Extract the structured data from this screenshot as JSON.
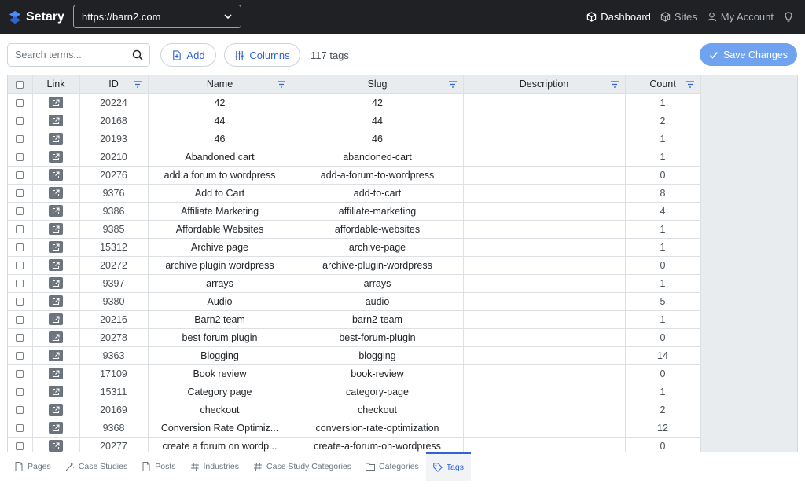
{
  "app": {
    "name": "Setary"
  },
  "site_select": {
    "value": "https://barn2.com"
  },
  "nav": [
    {
      "label": "Dashboard",
      "icon": "cube-icon",
      "active": true
    },
    {
      "label": "Sites",
      "icon": "cubes-icon",
      "active": false
    },
    {
      "label": "My Account",
      "icon": "user-icon",
      "active": false
    }
  ],
  "toolbar": {
    "search_placeholder": "Search terms...",
    "add_label": "Add",
    "columns_label": "Columns",
    "count_text": "117 tags",
    "save_label": "Save Changes"
  },
  "table": {
    "columns": [
      "Link",
      "ID",
      "Name",
      "Slug",
      "Description",
      "Count"
    ],
    "rows": [
      {
        "id": "20224",
        "name": "42",
        "slug": "42",
        "description": "",
        "count": "1"
      },
      {
        "id": "20168",
        "name": "44",
        "slug": "44",
        "description": "",
        "count": "2"
      },
      {
        "id": "20193",
        "name": "46",
        "slug": "46",
        "description": "",
        "count": "1"
      },
      {
        "id": "20210",
        "name": "Abandoned cart",
        "slug": "abandoned-cart",
        "description": "",
        "count": "1"
      },
      {
        "id": "20276",
        "name": "add a forum to wordpress",
        "slug": "add-a-forum-to-wordpress",
        "description": "",
        "count": "0"
      },
      {
        "id": "9376",
        "name": "Add to Cart",
        "slug": "add-to-cart",
        "description": "",
        "count": "8"
      },
      {
        "id": "9386",
        "name": "Affiliate Marketing",
        "slug": "affiliate-marketing",
        "description": "",
        "count": "4"
      },
      {
        "id": "9385",
        "name": "Affordable Websites",
        "slug": "affordable-websites",
        "description": "",
        "count": "1"
      },
      {
        "id": "15312",
        "name": "Archive page",
        "slug": "archive-page",
        "description": "",
        "count": "1"
      },
      {
        "id": "20272",
        "name": "archive plugin wordpress",
        "slug": "archive-plugin-wordpress",
        "description": "",
        "count": "0"
      },
      {
        "id": "9397",
        "name": "arrays",
        "slug": "arrays",
        "description": "",
        "count": "1"
      },
      {
        "id": "9380",
        "name": "Audio",
        "slug": "audio",
        "description": "",
        "count": "5"
      },
      {
        "id": "20216",
        "name": "Barn2 team",
        "slug": "barn2-team",
        "description": "",
        "count": "1"
      },
      {
        "id": "20278",
        "name": "best forum plugin",
        "slug": "best-forum-plugin",
        "description": "",
        "count": "0"
      },
      {
        "id": "9363",
        "name": "Blogging",
        "slug": "blogging",
        "description": "",
        "count": "14"
      },
      {
        "id": "17109",
        "name": "Book review",
        "slug": "book-review",
        "description": "",
        "count": "0"
      },
      {
        "id": "15311",
        "name": "Category page",
        "slug": "category-page",
        "description": "",
        "count": "1"
      },
      {
        "id": "20169",
        "name": "checkout",
        "slug": "checkout",
        "description": "",
        "count": "2"
      },
      {
        "id": "9368",
        "name": "Conversion Rate Optimiz...",
        "slug": "conversion-rate-optimization",
        "description": "",
        "count": "12"
      },
      {
        "id": "20277",
        "name": "create a forum on wordp...",
        "slug": "create-a-forum-on-wordpress",
        "description": "",
        "count": "0"
      }
    ]
  },
  "bottom_tabs": [
    {
      "label": "Pages",
      "icon": "page-icon",
      "active": false
    },
    {
      "label": "Case Studies",
      "icon": "magic-icon",
      "active": false
    },
    {
      "label": "Posts",
      "icon": "page-icon",
      "active": false
    },
    {
      "label": "Industries",
      "icon": "hash-icon",
      "active": false
    },
    {
      "label": "Case Study Categories",
      "icon": "hash-icon",
      "active": false
    },
    {
      "label": "Categories",
      "icon": "folder-icon",
      "active": false
    },
    {
      "label": "Tags",
      "icon": "tag-icon",
      "active": true
    }
  ],
  "colors": {
    "topbar": "#1f2124",
    "accent": "#2f63d6",
    "save_button": "#6fa3ef"
  }
}
